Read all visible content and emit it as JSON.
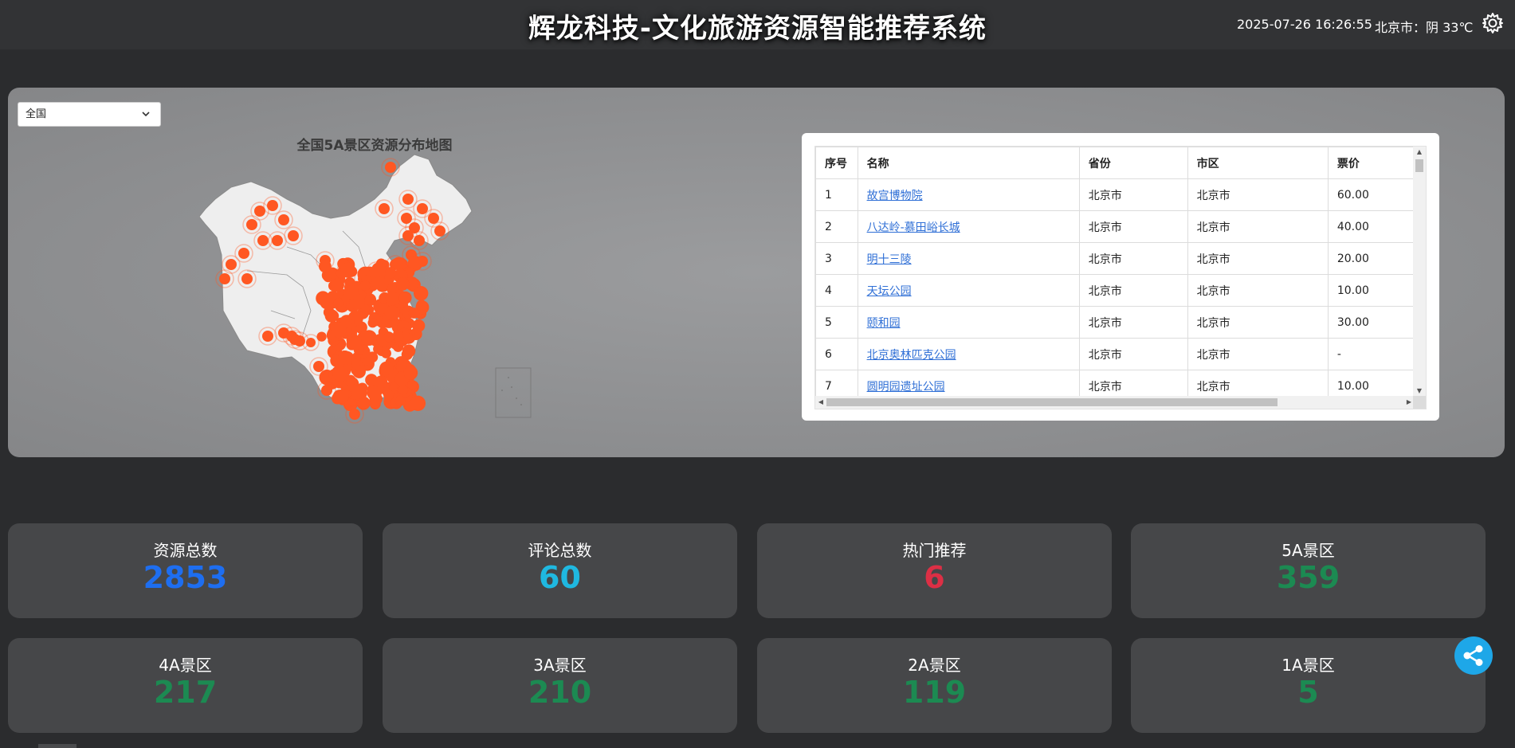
{
  "header": {
    "title": "辉龙科技-文化旅游资源智能推荐系统",
    "datetime": "2025-07-26 16:26:55",
    "weather": "北京市：阴 33℃",
    "settings_icon": "gear-icon"
  },
  "map_panel": {
    "region_select": {
      "value": "全国",
      "icon": "chevron-down-icon"
    },
    "map_title": "全国5A景区资源分布地图",
    "colors": {
      "map_fill": "#eeeeee",
      "map_border": "#8a8a8a",
      "point": "#ff5722",
      "panel_bg": "#8f9092"
    }
  },
  "table": {
    "columns": [
      "序号",
      "名称",
      "省份",
      "市区",
      "票价"
    ],
    "rows": [
      {
        "no": "1",
        "name": "故宫博物院",
        "province": "北京市",
        "city": "北京市",
        "price": "60.00"
      },
      {
        "no": "2",
        "name": "八达岭-慕田峪长城",
        "province": "北京市",
        "city": "北京市",
        "price": "40.00"
      },
      {
        "no": "3",
        "name": "明十三陵",
        "province": "北京市",
        "city": "北京市",
        "price": "20.00"
      },
      {
        "no": "4",
        "name": "天坛公园",
        "province": "北京市",
        "city": "北京市",
        "price": "10.00"
      },
      {
        "no": "5",
        "name": "颐和园",
        "province": "北京市",
        "city": "北京市",
        "price": "30.00"
      },
      {
        "no": "6",
        "name": "北京奥林匹克公园",
        "province": "北京市",
        "city": "北京市",
        "price": "-"
      },
      {
        "no": "7",
        "name": "圆明园遗址公园",
        "province": "北京市",
        "city": "北京市",
        "price": "10.00"
      }
    ]
  },
  "stats": [
    {
      "label": "资源总数",
      "value": "2853",
      "color": "#1e6ef0"
    },
    {
      "label": "评论总数",
      "value": "60",
      "color": "#1fb8e0"
    },
    {
      "label": "热门推荐",
      "value": "6",
      "color": "#dc2f45"
    },
    {
      "label": "5A景区",
      "value": "359",
      "color": "#1c8a52"
    },
    {
      "label": "4A景区",
      "value": "217",
      "color": "#1c8a52"
    },
    {
      "label": "3A景区",
      "value": "210",
      "color": "#1c8a52"
    },
    {
      "label": "2A景区",
      "value": "119",
      "color": "#1c8a52"
    },
    {
      "label": "1A景区",
      "value": "5",
      "color": "#1c8a52"
    }
  ],
  "share_button": {
    "icon": "share-icon",
    "color": "#1ea7e8"
  }
}
